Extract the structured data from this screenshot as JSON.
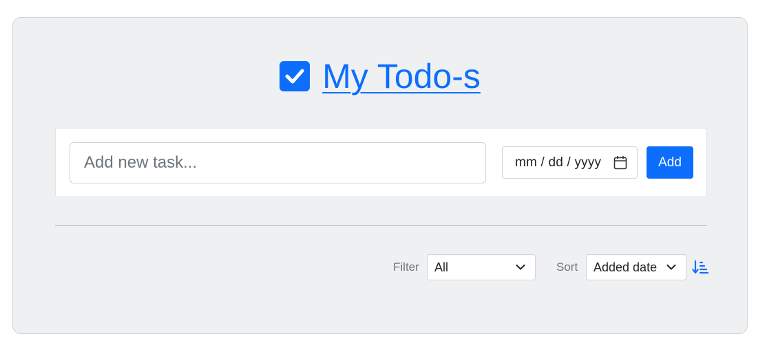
{
  "header": {
    "title": "My Todo-s",
    "icon": "checkbox-checked-icon"
  },
  "add_task": {
    "placeholder": "Add new task...",
    "date_placeholder": "mm / dd / yyyy",
    "add_label": "Add"
  },
  "controls": {
    "filter_label": "Filter",
    "filter_value": "All",
    "sort_label": "Sort",
    "sort_value": "Added date",
    "sort_direction_icon": "sort-numeric-down-icon"
  },
  "colors": {
    "accent": "#0d6efd",
    "card_bg": "#eff0f2",
    "muted_text": "#6c757d"
  }
}
